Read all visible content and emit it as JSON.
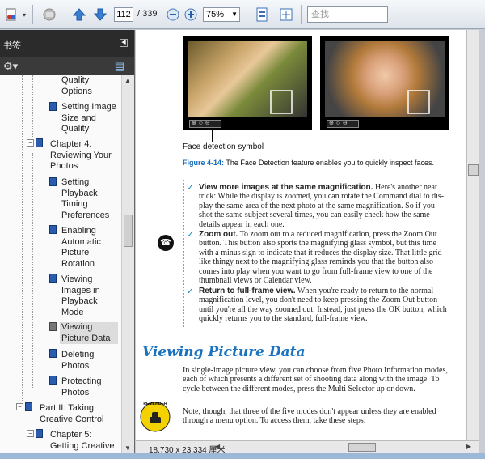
{
  "toolbar": {
    "current_page": "112",
    "total_pages": "/ 339",
    "zoom": "75%",
    "search_placeholder": "查找"
  },
  "sidebar": {
    "title": "书签",
    "items": [
      {
        "label": "Quality\nOptions",
        "level": 2
      },
      {
        "label": "Setting Image\nSize and\nQuality",
        "level": 2
      },
      {
        "label": "Chapter 4:\nReviewing Your\nPhotos",
        "level": 1
      },
      {
        "label": "Setting\nPlayback\nTiming\nPreferences",
        "level": 2
      },
      {
        "label": "Enabling\nAutomatic\nPicture\nRotation",
        "level": 2
      },
      {
        "label": "Viewing\nImages in\nPlayback\nMode",
        "level": 2
      },
      {
        "label": "Viewing\nPicture Data",
        "level": 2,
        "selected": true
      },
      {
        "label": "Deleting\nPhotos",
        "level": 2
      },
      {
        "label": "Protecting\nPhotos",
        "level": 2
      },
      {
        "label": "Part II: Taking\nCreative Control",
        "level": 0
      },
      {
        "label": "Chapter 5:\nGetting Creative",
        "level": 1
      }
    ]
  },
  "document": {
    "figure_label": "Face detection symbol",
    "figure_caption_num": "Figure 4-14:",
    "figure_caption_text": " The Face Detection feature enables you to quickly inspect faces.",
    "tips": [
      {
        "bold": "View more images at the same magnification.",
        "text": " Here's another neat trick: While the display is zoomed, you can rotate the Command dial to dis-play the same area of the next photo at the same magnification. So if you shot the same subject several times, you can easily check how the same details appear in each one."
      },
      {
        "bold": "Zoom out.",
        "text": " To zoom out to a reduced magnification, press the Zoom Out button. This button also sports the magnifying glass symbol, but this time with a minus sign to indicate that it reduces the display size. That little grid-like thingy next to the magnifying glass reminds you that the button also comes into play when you want to go from full-frame view to one of the thumbnail views or Calendar view."
      },
      {
        "bold": "Return to full-frame view.",
        "text": " When you're ready to return to the normal magnification level, you don't need to keep pressing the Zoom Out button until you're all the way zoomed out. Instead, just press the OK button, which quickly returns you to the standard, full-frame view."
      }
    ],
    "heading": "Viewing Picture Data",
    "para1": "In single-image picture view, you can choose from five Photo Information modes, each of which presents a different set of shooting data along with the image. To cycle between the different modes, press the Multi Selector up or down.",
    "para2": "Note, though, that three of the five modes don't appear unless they are enabled through a menu option. To access them, take these steps:",
    "remember_label": "REMEMBER"
  },
  "status": {
    "page_size": "18.730 x 23.334 厘米"
  }
}
